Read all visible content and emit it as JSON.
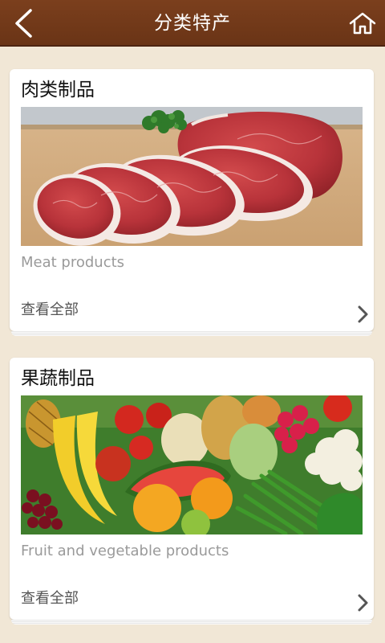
{
  "header": {
    "title": "分类特产",
    "back_icon": "back-arrow-icon",
    "home_icon": "home-icon"
  },
  "categories": [
    {
      "title": "肉类制品",
      "subtitle": "Meat products",
      "link": "查看全部",
      "image": "raw sliced beef steaks with parsley garnish"
    },
    {
      "title": "果蔬制品",
      "subtitle": "Fruit and vegetable products",
      "link": "查看全部",
      "image": "assorted fruits and vegetables"
    }
  ],
  "colors": {
    "header_bg": "#7b3f1d",
    "page_bg": "#f1e7d6"
  }
}
